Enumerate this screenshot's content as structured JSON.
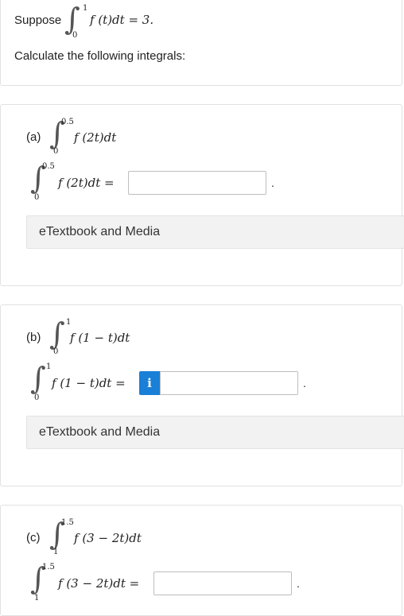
{
  "intro": {
    "prefix": "Suppose",
    "upper": "1",
    "lower": "0",
    "integrand": "f (t)dt = 3.",
    "instruction": "Calculate the following integrals:"
  },
  "parts": [
    {
      "label": "(a)",
      "upper": "0.5",
      "lower": "0",
      "integrand": "f (2t)dt",
      "answer_lhs": "f (2t)dt  =",
      "answer_value": "",
      "ebook": "eTextbook and Media"
    },
    {
      "label": "(b)",
      "upper": "1",
      "lower": "0",
      "integrand": "f (1 − t)dt",
      "answer_lhs": "f (1 − t)dt  =",
      "answer_value": "",
      "info_icon_text": "i",
      "ebook": "eTextbook and Media"
    },
    {
      "label": "(c)",
      "upper": "1.5",
      "lower": "1",
      "integrand": "f (3 − 2t)dt",
      "answer_lhs": "f (3 − 2t)dt  =",
      "answer_value": ""
    }
  ],
  "period": "."
}
